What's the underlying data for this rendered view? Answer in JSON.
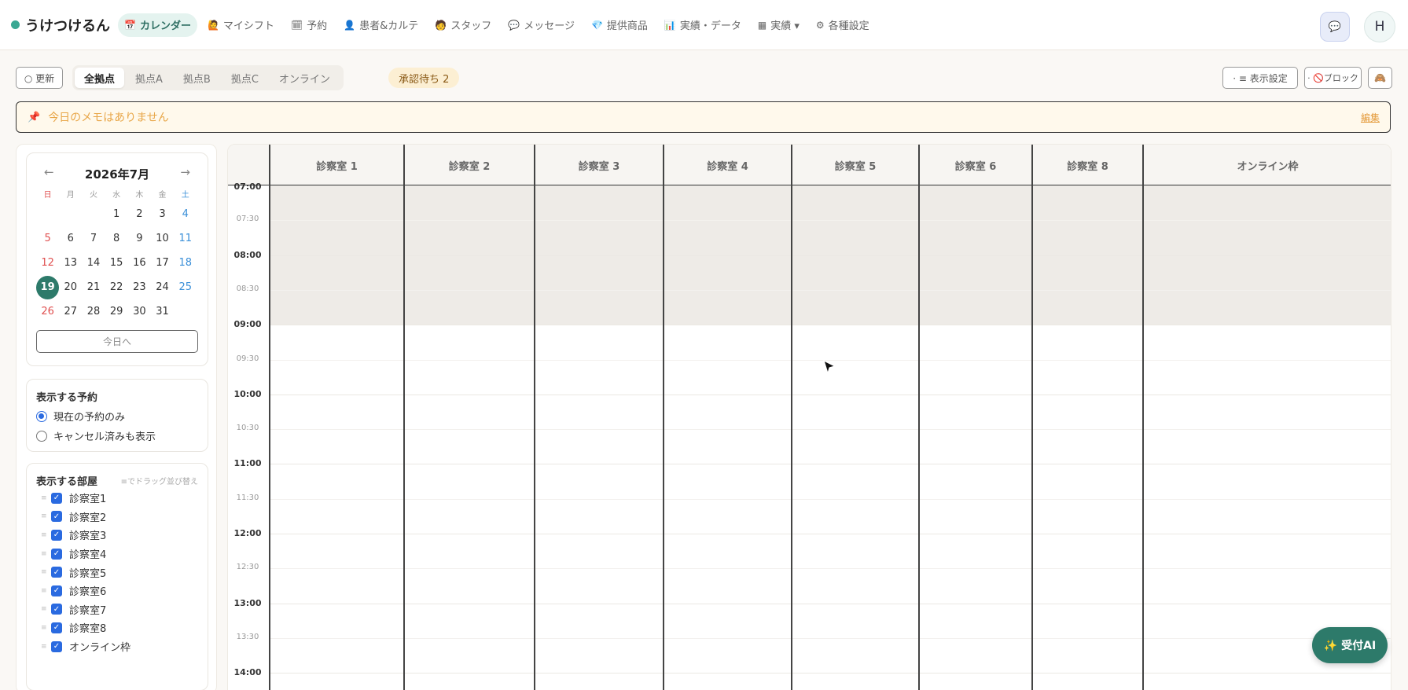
{
  "app": {
    "name": "うけつけるん",
    "accent": "#2d7a6a"
  },
  "nav": [
    {
      "icon": "calendar-icon",
      "glyph": "📅",
      "label": "カレンダー",
      "active": true
    },
    {
      "icon": "person-raise-icon",
      "glyph": "🙋",
      "label": "マイシフト"
    },
    {
      "icon": "memo-calendar-icon",
      "glyph": "🗓",
      "label": "予約"
    },
    {
      "icon": "user-icon",
      "glyph": "👤",
      "label": "患者&カルテ"
    },
    {
      "icon": "staff-icon",
      "glyph": "🧑",
      "label": "スタッフ"
    },
    {
      "icon": "speech-bubble-icon",
      "glyph": "💬",
      "label": "メッセージ"
    },
    {
      "icon": "gem-icon",
      "glyph": "💎",
      "label": "提供商品"
    },
    {
      "icon": "bar-chart-icon",
      "glyph": "📊",
      "label": "実績・データ"
    },
    {
      "icon": "list-icon",
      "glyph": "▦",
      "label": "実績 ▾"
    },
    {
      "icon": "gear-icon",
      "glyph": "⚙",
      "label": "各種設定"
    }
  ],
  "header_right": {
    "chat_icon": "chat-icon",
    "avatar": "H"
  },
  "toolbar": {
    "refresh": "○ 更新",
    "locations": [
      "全拠点",
      "拠点A",
      "拠点B",
      "拠点C",
      "オンライン"
    ],
    "active_location": 0,
    "pending": "承認待ち 2",
    "display_settings": "· ≡ 表示設定",
    "block": "· 🚫ブロック",
    "extra_icon": "extra-icon"
  },
  "memo": {
    "text": "今日のメモはありません",
    "edit": "編集"
  },
  "calendar": {
    "title": "2026年7月",
    "prev": "←",
    "next": "→",
    "weekdays": [
      "日",
      "月",
      "火",
      "水",
      "木",
      "金",
      "土"
    ],
    "first_weekday": 3,
    "days_in_month": 31,
    "selected": 19,
    "today_button": "今日へ"
  },
  "display_reservations": {
    "title": "表示する予約",
    "options": [
      {
        "label": "現在の予約のみ",
        "checked": true
      },
      {
        "label": "キャンセル済みも表示",
        "checked": false
      }
    ]
  },
  "rooms_panel": {
    "title": "表示する部屋",
    "hint": "≡でドラッグ並び替え",
    "rooms": [
      "診察室1",
      "診察室2",
      "診察室3",
      "診察室4",
      "診察室5",
      "診察室6",
      "診察室7",
      "診察室8",
      "オンライン枠"
    ]
  },
  "schedule": {
    "columns": [
      "診察室 1",
      "診察室 2",
      "診察室 3",
      "診察室 4",
      "診察室 5",
      "診察室 6",
      "診察室 8",
      "オンライン枠"
    ],
    "times": [
      "07:00",
      "07:30",
      "08:00",
      "08:30",
      "09:00",
      "09:30",
      "10:00",
      "10:30",
      "11:00",
      "11:30",
      "12:00",
      "12:30",
      "13:00",
      "13:30",
      "14:00"
    ],
    "business_start": "09:00"
  },
  "ai_button": "✨ 受付AI"
}
